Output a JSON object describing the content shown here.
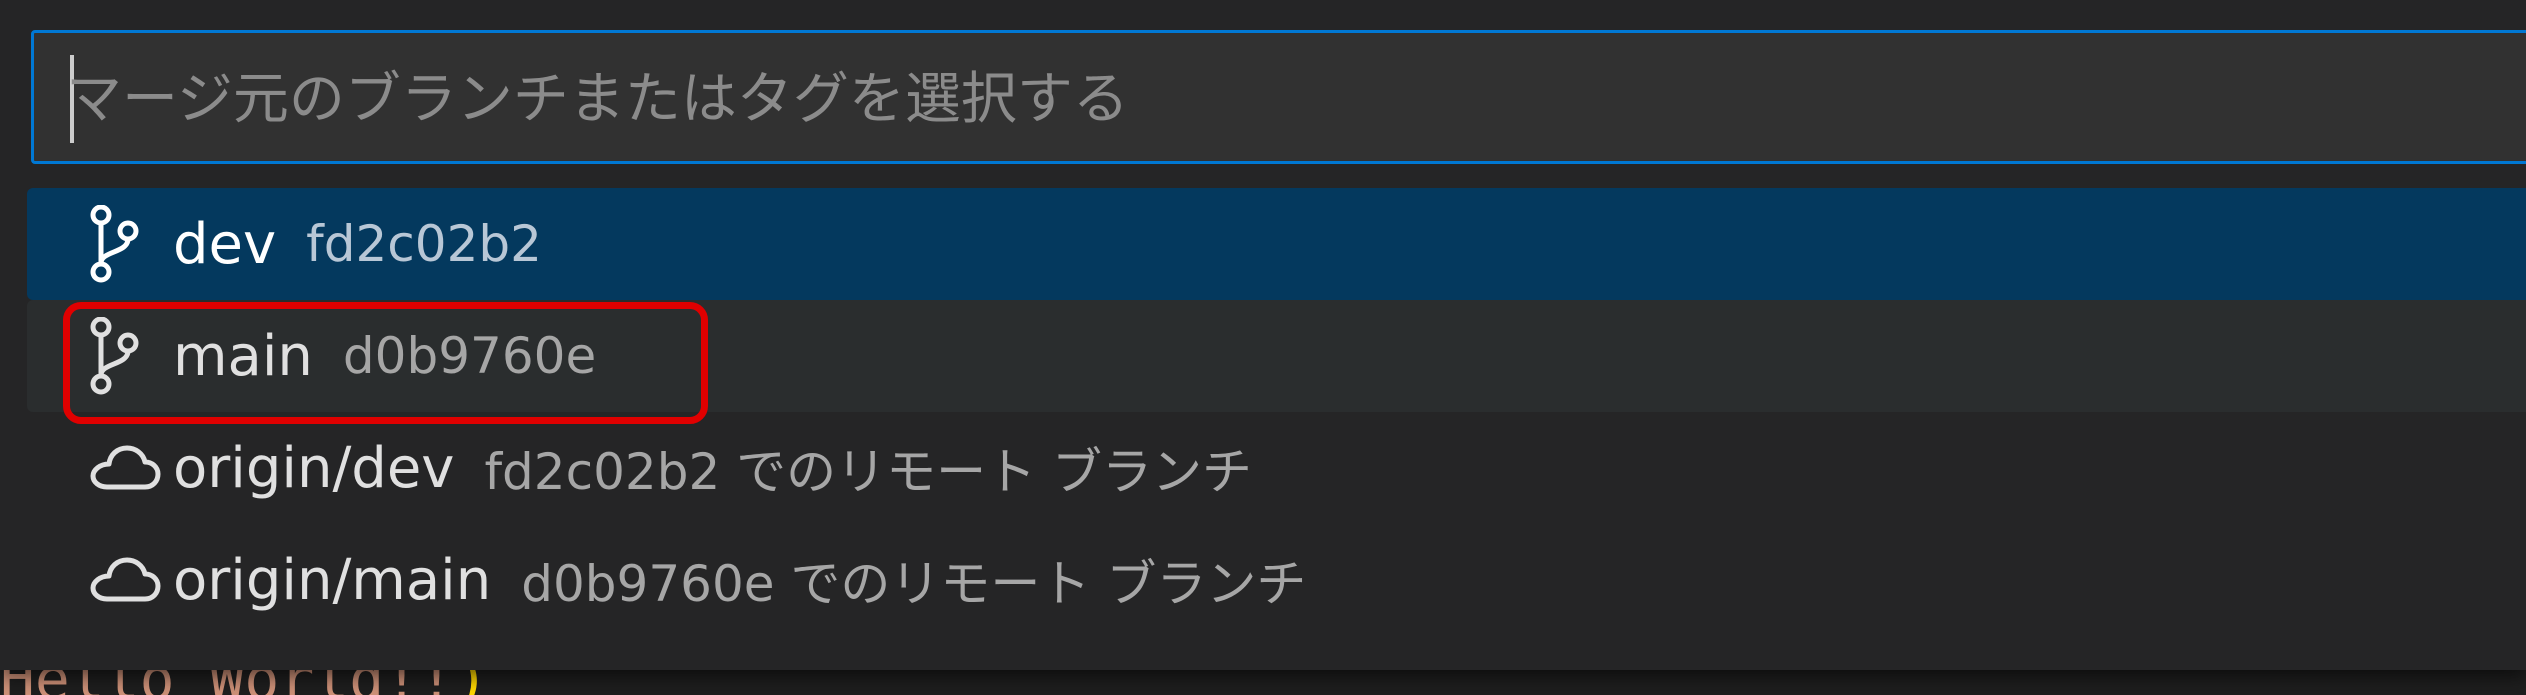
{
  "search": {
    "placeholder": "マージ元のブランチまたはタグを選択する",
    "value": ""
  },
  "items": [
    {
      "icon": "git-branch-icon",
      "label": "dev",
      "description": "fd2c02b2"
    },
    {
      "icon": "git-branch-icon",
      "label": "main",
      "description": "d0b9760e"
    },
    {
      "icon": "cloud-icon",
      "label": "origin/dev",
      "description": "fd2c02b2 でのリモート ブランチ"
    },
    {
      "icon": "cloud-icon",
      "label": "origin/main",
      "description": "d0b9760e でのリモート ブランチ"
    }
  ],
  "editor_peek": {
    "text": "Hello World!!",
    "paren": ")"
  },
  "colors": {
    "accent": "#0078d4",
    "active_row": "#04395e",
    "highlight": "#e00000"
  }
}
